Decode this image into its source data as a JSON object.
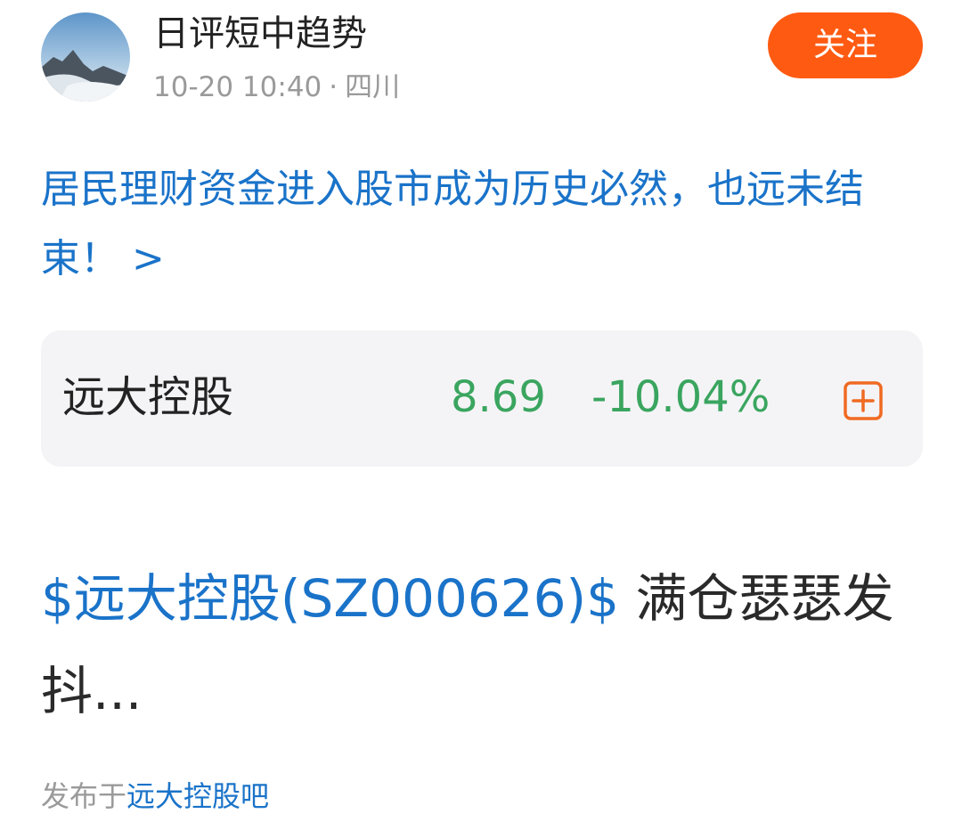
{
  "author": {
    "name": "日评短中趋势",
    "time": "10-20 10:40",
    "separator": "·",
    "location": "四川",
    "follow_label": "关注"
  },
  "post": {
    "title": "居民理财资金进入股市成为历史必然，也远未结束！ >",
    "body_link": "$远大控股(SZ000626)$",
    "body_text": " 满仓瑟瑟发抖..."
  },
  "stock": {
    "name": "远大控股",
    "price": "8.69",
    "change": "-10.04%",
    "price_color": "#3aa55f",
    "add_icon": "plus-square-icon"
  },
  "footer": {
    "prefix": "发布于",
    "forum": "远大控股吧"
  },
  "colors": {
    "accent": "#ff5a12",
    "link": "#1a73c9"
  }
}
